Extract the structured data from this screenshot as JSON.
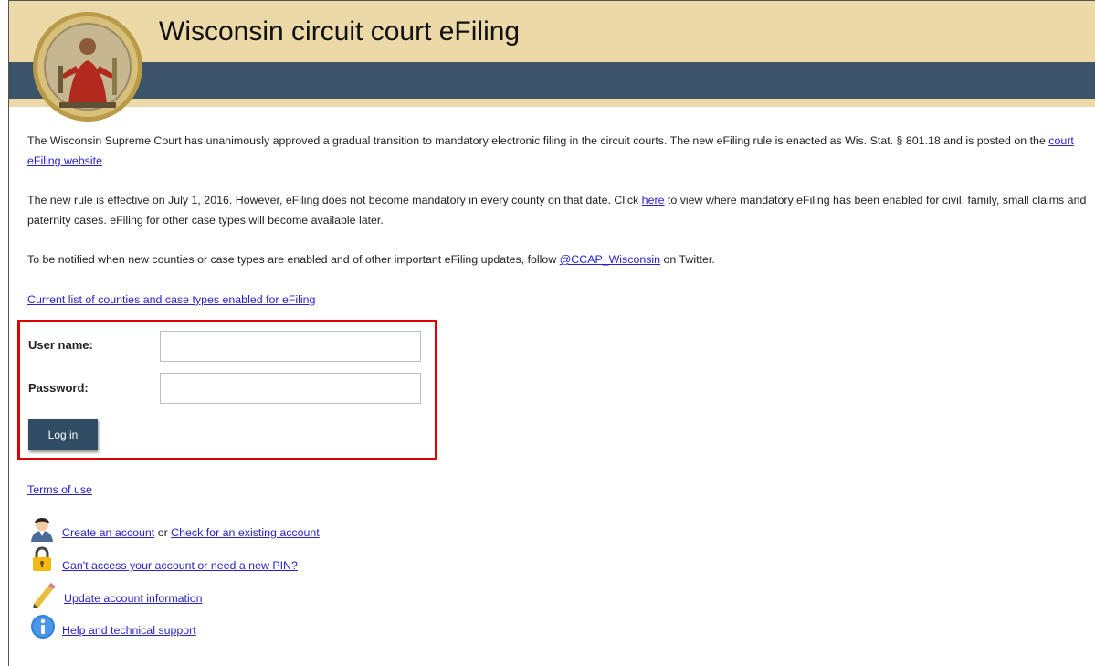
{
  "header": {
    "title": "Wisconsin circuit court eFiling"
  },
  "intro": {
    "p1_text": "The Wisconsin Supreme Court has unanimously approved a gradual transition to mandatory electronic filing in the circuit courts. The new eFiling rule is enacted as Wis. Stat. § 801.18 and is posted on the ",
    "p1_link": "court eFiling website",
    "p1_end": ".",
    "p2_text": "The new rule is effective on July 1, 2016. However, eFiling does not become mandatory in every county on that date. Click ",
    "p2_link": "here",
    "p2_end": " to view where mandatory eFiling has been enabled for civil, family, small claims and paternity cases. eFiling for other case types will become available later.",
    "p3_text": "To be notified when new counties or case types are enabled and of other important eFiling updates, follow ",
    "p3_link": "@CCAP_Wisconsin",
    "p3_end": " on Twitter.",
    "counties_link": "Current list of counties and case types enabled for eFiling"
  },
  "login": {
    "username_label": "User name:",
    "username_value": "",
    "password_label": "Password:",
    "password_value": "",
    "button_label": "Log in",
    "highlight_color": "#e00000"
  },
  "links": {
    "terms": "Terms of use",
    "create_account": "Create an account",
    "or_text": " or ",
    "check_account": "Check for an existing account",
    "cant_access": "Can't access your account or need a new PIN?",
    "update_info": "Update account information",
    "help": "Help and technical support"
  },
  "icons": [
    "user-icon",
    "lock-icon",
    "pencil-icon",
    "info-icon"
  ],
  "colors": {
    "header_band": "#ecd9a8",
    "nav_band": "#3c5469",
    "button_bg": "#2f4c64",
    "link": "#2a22c8"
  }
}
